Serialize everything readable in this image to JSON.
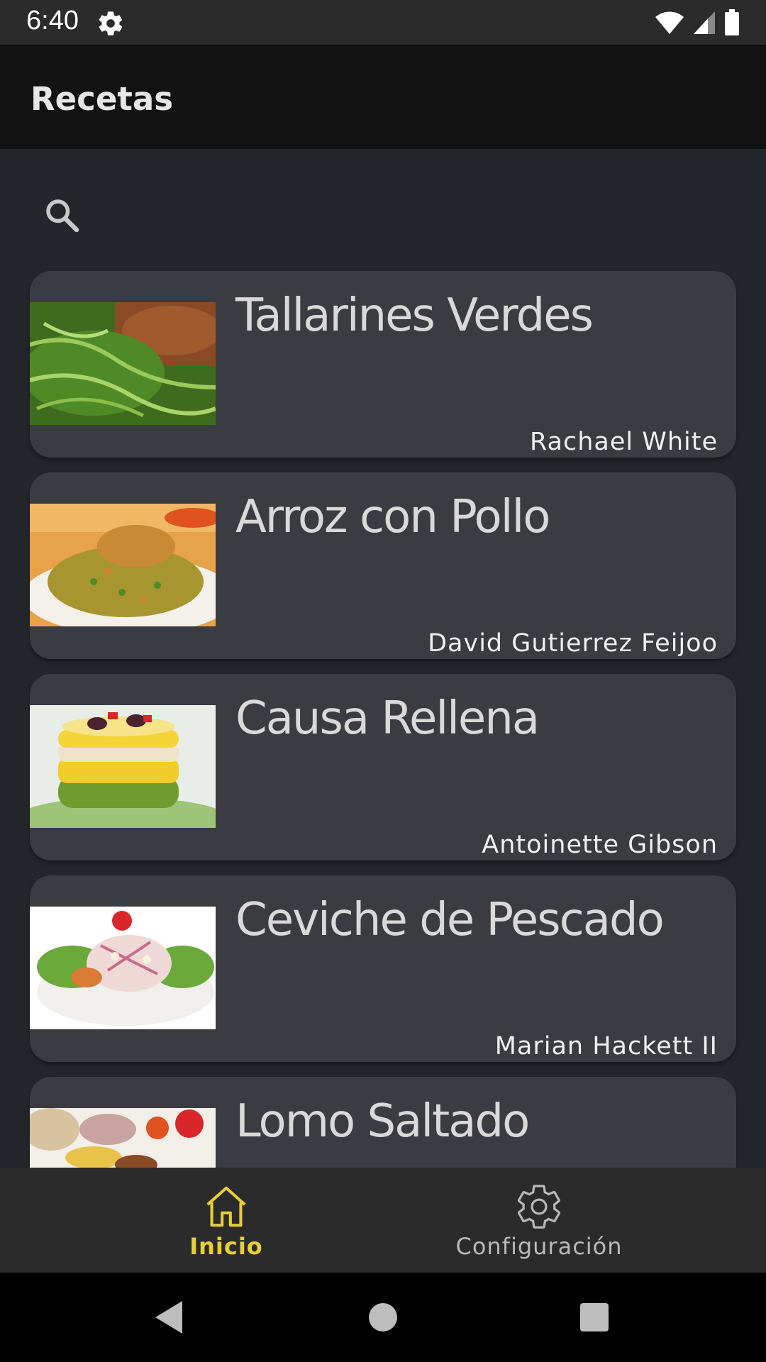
{
  "status_bar": {
    "time": "6:40"
  },
  "app_bar": {
    "title": "Recetas"
  },
  "search": {
    "placeholder": ""
  },
  "recipes": [
    {
      "title": "Tallarines Verdes",
      "author": "Rachael White"
    },
    {
      "title": "Arroz con Pollo",
      "author": "David Gutierrez Feijoo"
    },
    {
      "title": "Causa Rellena",
      "author": "Antoinette Gibson"
    },
    {
      "title": "Ceviche de Pescado",
      "author": "Marian Hackett II"
    },
    {
      "title": "Lomo Saltado",
      "author": ""
    }
  ],
  "bottom_nav": {
    "items": [
      {
        "label": "Inicio",
        "icon": "home-icon",
        "active": true
      },
      {
        "label": "Configuración",
        "icon": "gear-icon",
        "active": false
      }
    ]
  },
  "colors": {
    "accent": "#e8cf3a",
    "background": "#23262b",
    "card": "#3a3c42",
    "app_bar": "#121212"
  }
}
